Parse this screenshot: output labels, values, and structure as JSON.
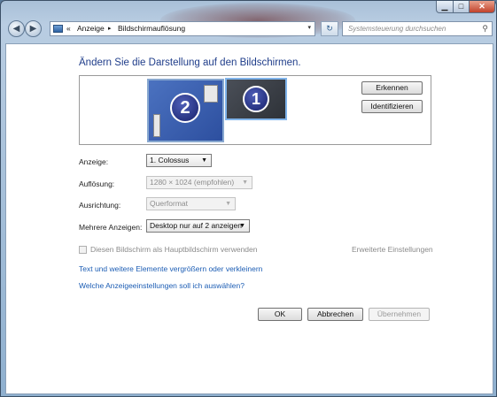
{
  "window": {
    "controls": {
      "minimize": "▁",
      "maximize": "□",
      "close": "✕"
    }
  },
  "nav": {
    "back_icon": "◀",
    "forward_icon": "▶",
    "breadcrumb": [
      "Anzeige",
      "Bildschirmauflösung"
    ],
    "breadcrumb_prefix": "«",
    "separator": "▸",
    "dropdown_icon": "▾",
    "refresh_icon": "↻",
    "search_placeholder": "Systemsteuerung durchsuchen",
    "search_icon": "⚲"
  },
  "main": {
    "heading": "Ändern Sie die Darstellung auf den Bildschirmen.",
    "monitors": [
      {
        "number": "2",
        "selected": true
      },
      {
        "number": "1",
        "selected": false
      }
    ],
    "detect_button": "Erkennen",
    "identify_button": "Identifizieren",
    "fields": {
      "display": {
        "label": "Anzeige:",
        "value": "1. Colossus",
        "enabled": true
      },
      "resolution": {
        "label": "Auflösung:",
        "value": "1280 × 1024 (empfohlen)",
        "enabled": false
      },
      "orientation": {
        "label": "Ausrichtung:",
        "value": "Querformat",
        "enabled": false
      },
      "multiple": {
        "label": "Mehrere Anzeigen:",
        "value": "Desktop nur auf 2 anzeigen",
        "enabled": true
      }
    },
    "primary_checkbox_label": "Diesen Bildschirm als Hauptbildschirm verwenden",
    "primary_checked": false,
    "advanced_link": "Erweiterte Einstellungen",
    "links": [
      "Text und weitere Elemente vergrößern oder verkleinern",
      "Welche Anzeigeeinstellungen soll ich auswählen?"
    ],
    "buttons": {
      "ok": "OK",
      "cancel": "Abbrechen",
      "apply": "Übernehmen"
    }
  },
  "colors": {
    "heading": "#1f3d8a",
    "link": "#1c5db4"
  }
}
